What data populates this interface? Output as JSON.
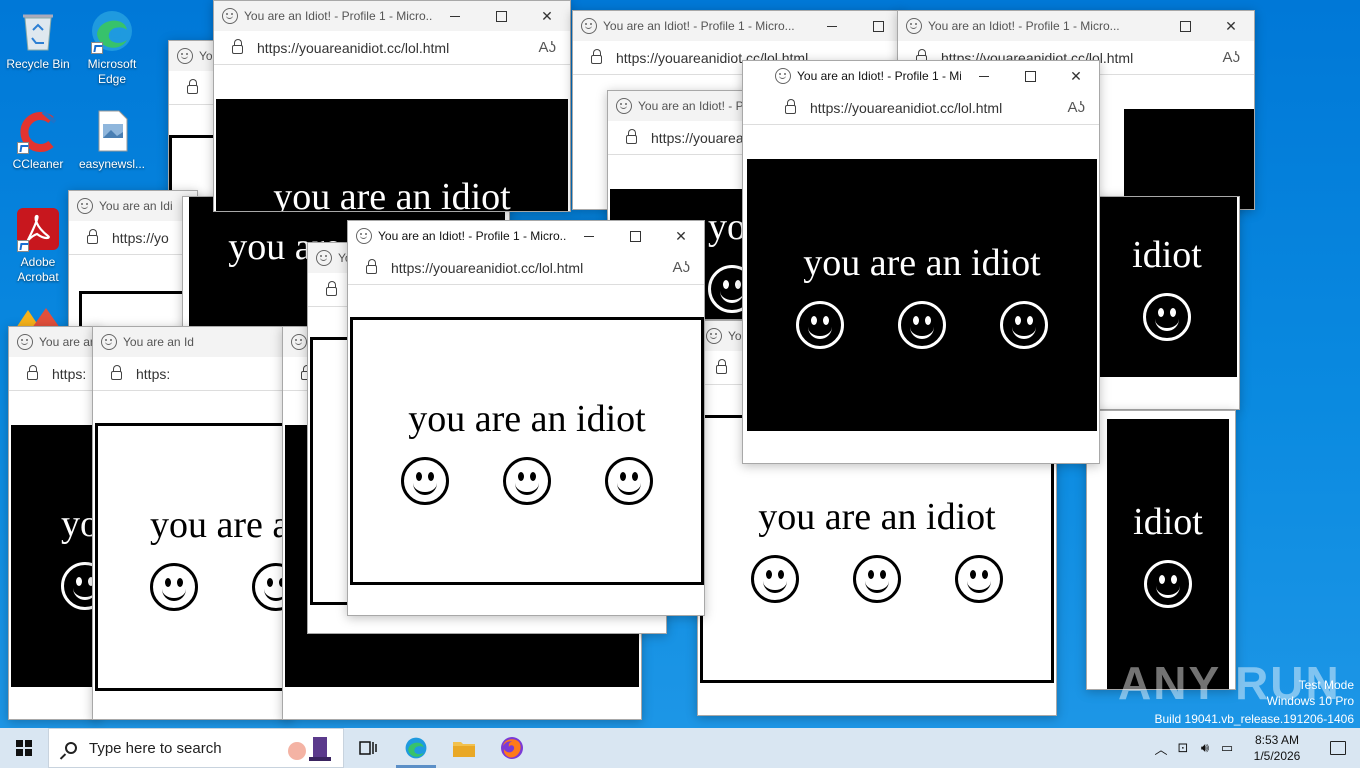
{
  "desktop": {
    "icons": [
      {
        "label": "Recycle Bin"
      },
      {
        "label": "Microsoft Edge"
      },
      {
        "label": "CCleaner"
      },
      {
        "label": "easynewsl..."
      },
      {
        "label": "Adobe Acrobat"
      }
    ]
  },
  "popup": {
    "title": "You are an Idiot! - Profile 1 - Micro...",
    "url": "https://youareanidiot.cc/lol.html",
    "message": "you are an idiot",
    "read_aloud_icon": "Aʖ"
  },
  "partial": {
    "title_short": "You are an Idi",
    "title_you": "You",
    "title_you_are_an": "You are an Id",
    "title_profile": "You are an Idiot! - Profile",
    "url_short": "https:",
    "url_mid": "https://youareanic",
    "url_tiny": "https://yo",
    "text_you": "you are a",
    "text_yo": "yo",
    "text_idiot": "idiot"
  },
  "taskbar": {
    "search_placeholder": "Type here to search",
    "time": "8:53 AM",
    "date": "1/5/2026",
    "apps": [
      "task-view",
      "edge",
      "file-explorer",
      "firefox"
    ]
  },
  "watermark": {
    "line1": "Test Mode",
    "line2": "Windows 10 Pro",
    "line3": "Build 19041.vb_release.191206-1406",
    "brand": "ANY RUN"
  },
  "colors": {
    "desktop": "#0078d7",
    "taskbar": "#d9e6f2",
    "titlebar": "#f3f3f3"
  }
}
